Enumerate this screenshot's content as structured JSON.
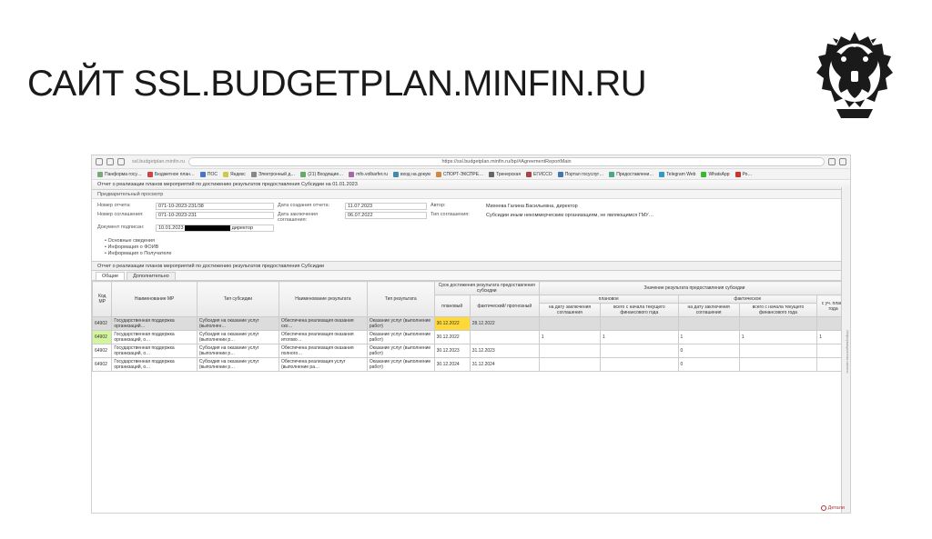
{
  "slide": {
    "title": "САЙТ SSL.BUDGETPLAN.MINFIN.RU"
  },
  "browser": {
    "url_display": "https://ssl.budgetplan.minfin.ru/bp/#AgreementReportMain",
    "url_host": "ssl.budgetplan.minfin.ru",
    "bookmarks": [
      "Панформа госу…",
      "Бюджетное план…",
      "ПОС",
      "Яндекс",
      "Электронный д…",
      "(21) Входящие…",
      "mfo.volbarfer.ru",
      "вход на докум",
      "СПОРТ-ЭКСПРЕ…",
      "Тренерская",
      "ЕГИССО",
      "Портал госуслуг…",
      "Предоставлени…",
      "Telegram Web",
      "WhatsApp",
      "Ро…"
    ]
  },
  "doc_header": "Отчет о реализации планов мероприятий по достижению результатов предоставления Субсидии на 01.01.2023",
  "section_label": "Предварительный просмотр",
  "form": {
    "labels": {
      "report_no": "Номер отчета:",
      "agreement_no": "Номер соглашения:",
      "doc_sign": "Документ подписан:",
      "report_date": "Дата создания отчета:",
      "agr_date": "Дата заключения соглашения:",
      "author": "Автор:",
      "agr_type": "Тип соглашения:",
      "director": "директор"
    },
    "values": {
      "report_no": "071-10-2023-231/38",
      "agreement_no": "071-10-2023-231",
      "doc_sign_date": "10.01.2023",
      "report_date": "11.07.2023",
      "agr_date": "06.07.2022",
      "author": "Михеева Галина Васильевна, директор",
      "agr_type": "Субсидии иным некоммерческим организациям, не являющимся ГМУ…"
    }
  },
  "tree": [
    "• Основные сведения",
    "• Информация о ФОИВ",
    "• Информация о Получателе"
  ],
  "report_title": "Отчет о реализации планов мероприятий по достижению результатов предоставления Субсидии",
  "tabs": {
    "t1": "Общие",
    "t2": "Дополнительно"
  },
  "grid": {
    "head_group1": "Срок достижения результата предоставления субсидии",
    "head_group2": "Значение результата предоставления субсидии",
    "head_group2a": "плановое",
    "head_group2b": "фактическое",
    "cols": [
      "Код МР",
      "Наименование МР",
      "Тип субсидии",
      "Наименование результата",
      "Тип результата",
      "плановый",
      "фактический/ прогнозный",
      "на дату заключения соглашения",
      "всего с начала текущего финансового года",
      "на дату заключения соглашения",
      "всего с начала текущего финансового года",
      "с уч. плана года"
    ],
    "rows": [
      {
        "code": "64902",
        "name": "Государственная поддержка организаций…",
        "type": "Субсидия на оказание услуг (выполнен…",
        "result_name": "Обеспечена реализация оказания ско…",
        "result_type": "Оказание услуг (выполнение работ)",
        "plan": "30.12.2022",
        "fact": "28.12.2022",
        "v1": "",
        "v2": "",
        "v3": "",
        "v4": "",
        "v5": "",
        "sel": true,
        "hl_plan": true
      },
      {
        "code": "64902",
        "name": "Государственная поддержка организаций, о…",
        "type": "Субсидия на оказание услуг (выполнении р…",
        "result_name": "Обеспечена реализация оказания итогово…",
        "result_type": "Оказание услуг (выполнение работ)",
        "plan": "30.12.2022",
        "fact": "",
        "v1": "1",
        "v2": "1",
        "v3": "1",
        "v4": "1",
        "v5": "1",
        "hl_code": true
      },
      {
        "code": "64902",
        "name": "Государственная поддержка организаций, о…",
        "type": "Субсидия на оказание услуг (выполнении р…",
        "result_name": "Обеспечена реализация оказания полного…",
        "result_type": "Оказание услуг (выполнение работ)",
        "plan": "30.12.2023",
        "fact": "31.12.2023",
        "v1": "",
        "v2": "",
        "v3": "0",
        "v4": "",
        "v5": ""
      },
      {
        "code": "64902",
        "name": "Государственная поддержка организаций, о…",
        "type": "Субсидия на оказание услуг (выполнении р…",
        "result_name": "Обеспечена реализация услуг (выполнение ра…",
        "result_type": "Оказание услуг (выполнение работ)",
        "plan": "30.12.2024",
        "fact": "31.12.2024",
        "v1": "",
        "v2": "",
        "v3": "0",
        "v4": "",
        "v5": ""
      }
    ]
  },
  "footer": "Детали",
  "right_rail": "Информационная панель"
}
